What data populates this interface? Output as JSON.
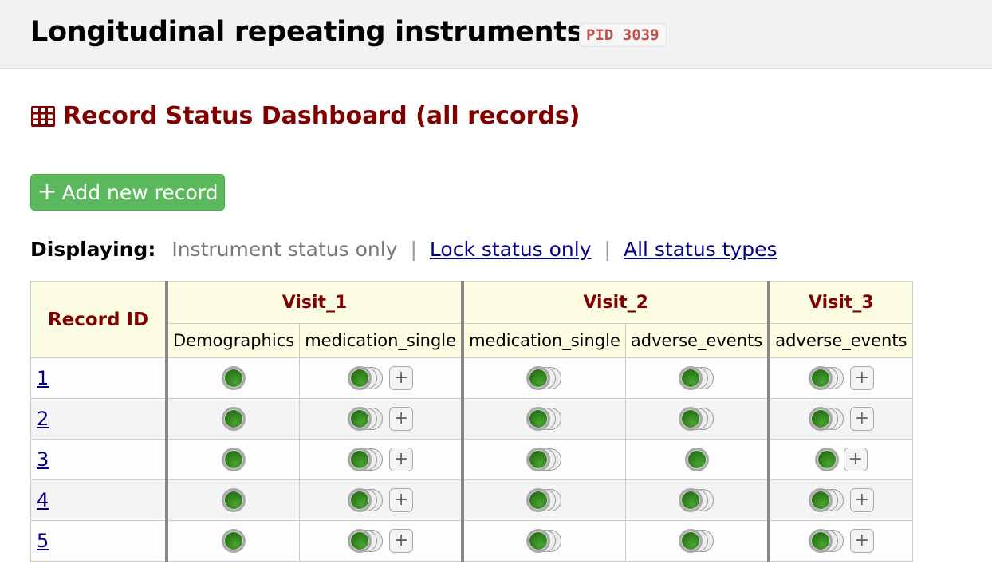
{
  "project": {
    "title": "Longitudinal repeating instruments",
    "pid_badge": "PID 3039"
  },
  "page": {
    "title": "Record Status Dashboard (all records)",
    "icon": "table-icon"
  },
  "add_record_button": {
    "label": "Add new record"
  },
  "displaying": {
    "label": "Displaying:",
    "current": "Instrument status only",
    "separator": "|",
    "links": [
      "Lock status only",
      "All status types"
    ]
  },
  "table": {
    "record_id_header": "Record ID",
    "events": [
      {
        "name": "Visit_1",
        "forms": [
          "Demographics",
          "medication_single"
        ]
      },
      {
        "name": "Visit_2",
        "forms": [
          "medication_single",
          "adverse_events"
        ]
      },
      {
        "name": "Visit_3",
        "forms": [
          "adverse_events"
        ]
      }
    ],
    "status_color": "#2e7d1c",
    "rows": [
      {
        "id": "1",
        "cells": [
          {
            "icon": "single"
          },
          {
            "icon": "multi",
            "plus": true
          },
          {
            "icon": "multi"
          },
          {
            "icon": "multi"
          },
          {
            "icon": "multi",
            "plus": true
          }
        ]
      },
      {
        "id": "2",
        "cells": [
          {
            "icon": "single"
          },
          {
            "icon": "multi",
            "plus": true
          },
          {
            "icon": "multi"
          },
          {
            "icon": "multi"
          },
          {
            "icon": "multi",
            "plus": true
          }
        ]
      },
      {
        "id": "3",
        "cells": [
          {
            "icon": "single"
          },
          {
            "icon": "multi",
            "plus": true
          },
          {
            "icon": "multi"
          },
          {
            "icon": "single"
          },
          {
            "icon": "single",
            "plus": true
          }
        ]
      },
      {
        "id": "4",
        "cells": [
          {
            "icon": "single"
          },
          {
            "icon": "multi",
            "plus": true
          },
          {
            "icon": "multi"
          },
          {
            "icon": "multi"
          },
          {
            "icon": "multi",
            "plus": true
          }
        ]
      },
      {
        "id": "5",
        "cells": [
          {
            "icon": "single"
          },
          {
            "icon": "multi",
            "plus": true
          },
          {
            "icon": "multi"
          },
          {
            "icon": "multi"
          },
          {
            "icon": "multi",
            "plus": true
          }
        ]
      }
    ],
    "plus_label": "+"
  }
}
